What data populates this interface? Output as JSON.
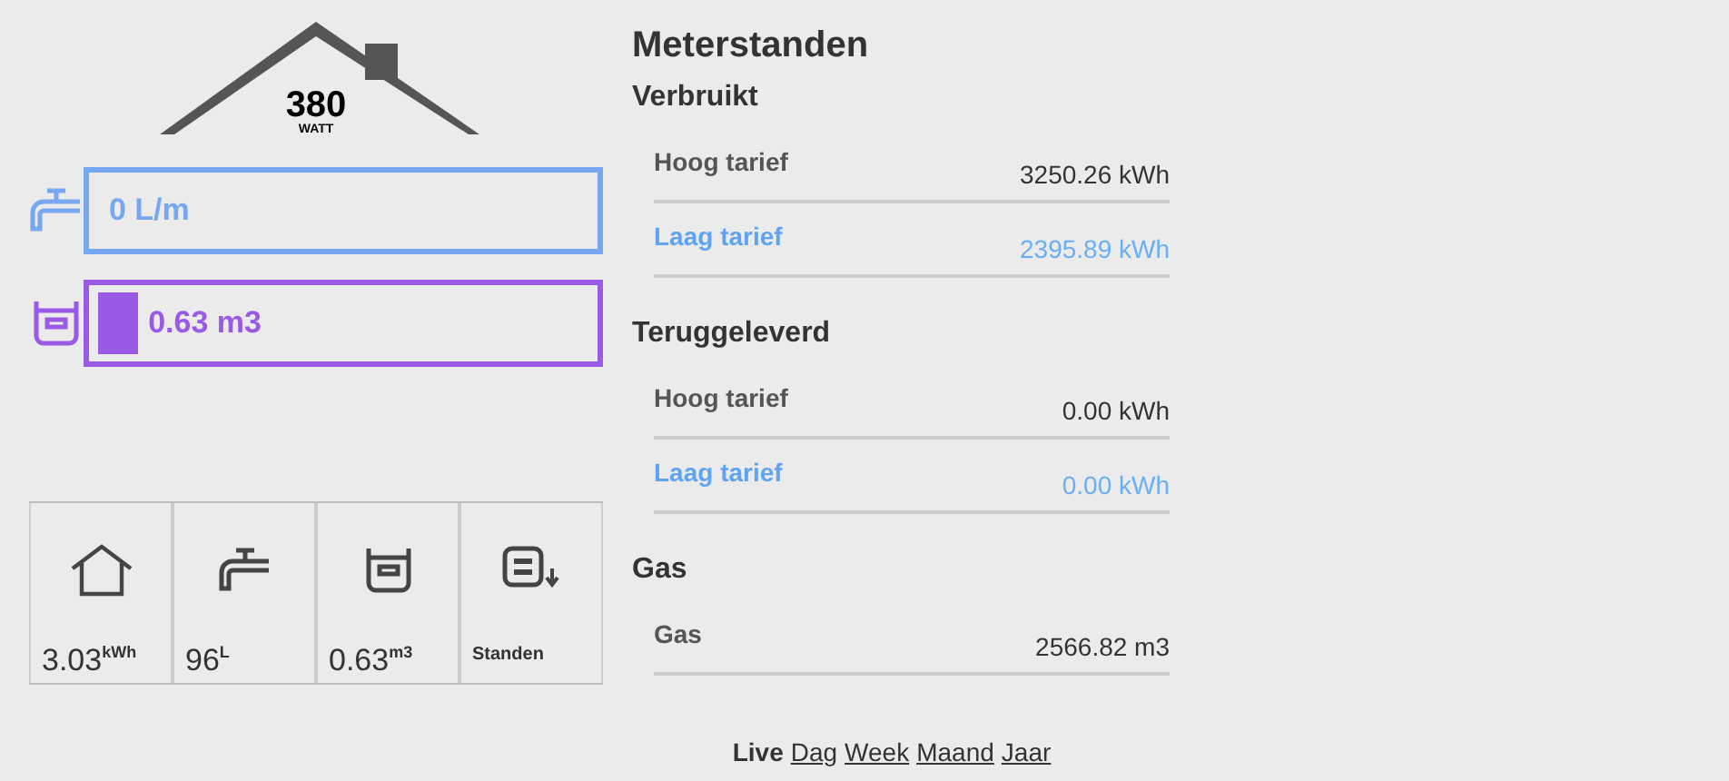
{
  "house": {
    "power": "380",
    "unit": "WATT"
  },
  "meters": [
    {
      "kind": "water",
      "color": "#76a7f0",
      "reading": "0 L/m"
    },
    {
      "kind": "gas",
      "color": "#9a5ae6",
      "level": 0.08,
      "reading": "0.63 m3"
    }
  ],
  "tiles": [
    {
      "kind": "house",
      "value": "3.03",
      "unit": "kWh"
    },
    {
      "kind": "water",
      "value": "96",
      "unit": "L"
    },
    {
      "kind": "gas",
      "value": "0.63",
      "unit": "m3"
    },
    {
      "kind": "readings",
      "label": "Standen"
    }
  ],
  "title": "Meterstanden",
  "sections": [
    {
      "heading": "Verbruikt",
      "rows": [
        {
          "kind": "high",
          "label": "Hoog tarief",
          "value": "3250.26 kWh"
        },
        {
          "kind": "low",
          "label": "Laag tarief",
          "value": "2395.89 kWh"
        }
      ]
    },
    {
      "heading": "Teruggeleverd",
      "rows": [
        {
          "kind": "high",
          "label": "Hoog tarief",
          "value": "0.00 kWh"
        },
        {
          "kind": "low",
          "label": "Laag tarief",
          "value": "0.00 kWh"
        }
      ]
    },
    {
      "heading": "Gas",
      "rows": [
        {
          "kind": "high",
          "label": "Gas",
          "value": "2566.82 m3"
        }
      ]
    }
  ],
  "periods": [
    {
      "label": "Live",
      "selected": true
    },
    {
      "label": "Dag",
      "selected": false
    },
    {
      "label": "Week",
      "selected": false
    },
    {
      "label": "Maand",
      "selected": false
    },
    {
      "label": "Jaar",
      "selected": false
    }
  ]
}
